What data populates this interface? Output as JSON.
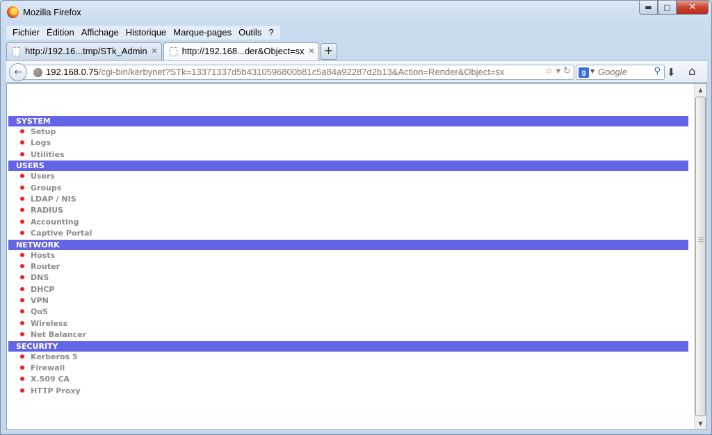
{
  "window": {
    "title": "Mozilla Firefox"
  },
  "menubar": {
    "items": [
      "Fichier",
      "Édition",
      "Affichage",
      "Historique",
      "Marque-pages",
      "Outils",
      "?"
    ]
  },
  "tabs": [
    {
      "label": "http://192.16...tmp/STk_Admin",
      "active": false
    },
    {
      "label": "http://192.168...der&Object=sx",
      "active": true
    }
  ],
  "navbar": {
    "url_host": "192.168.0.75",
    "url_path": "/cgi-bin/kerbynet?STk=13371337d5b4310596800b81c5a84a92287d2b13&Action=Render&Object=sx",
    "search_placeholder": "Google"
  },
  "sections": [
    {
      "title": "SYSTEM",
      "items": [
        "Setup",
        "Logs",
        "Utilities"
      ]
    },
    {
      "title": "USERS",
      "items": [
        "Users",
        "Groups",
        "LDAP / NIS",
        "RADIUS",
        "Accounting",
        "Captive Portal"
      ]
    },
    {
      "title": "NETWORK",
      "items": [
        "Hosts",
        "Router",
        "DNS",
        "DHCP",
        "VPN",
        "QoS",
        "Wireless",
        "Net Balancer"
      ]
    },
    {
      "title": "SECURITY",
      "items": [
        "Kerberos 5",
        "Firewall",
        "X.509 CA",
        "HTTP Proxy"
      ]
    }
  ],
  "colors": {
    "section_header_bg": "#6464e6",
    "bullet": "#ff1a1a",
    "item_text": "#8a8a8a"
  }
}
